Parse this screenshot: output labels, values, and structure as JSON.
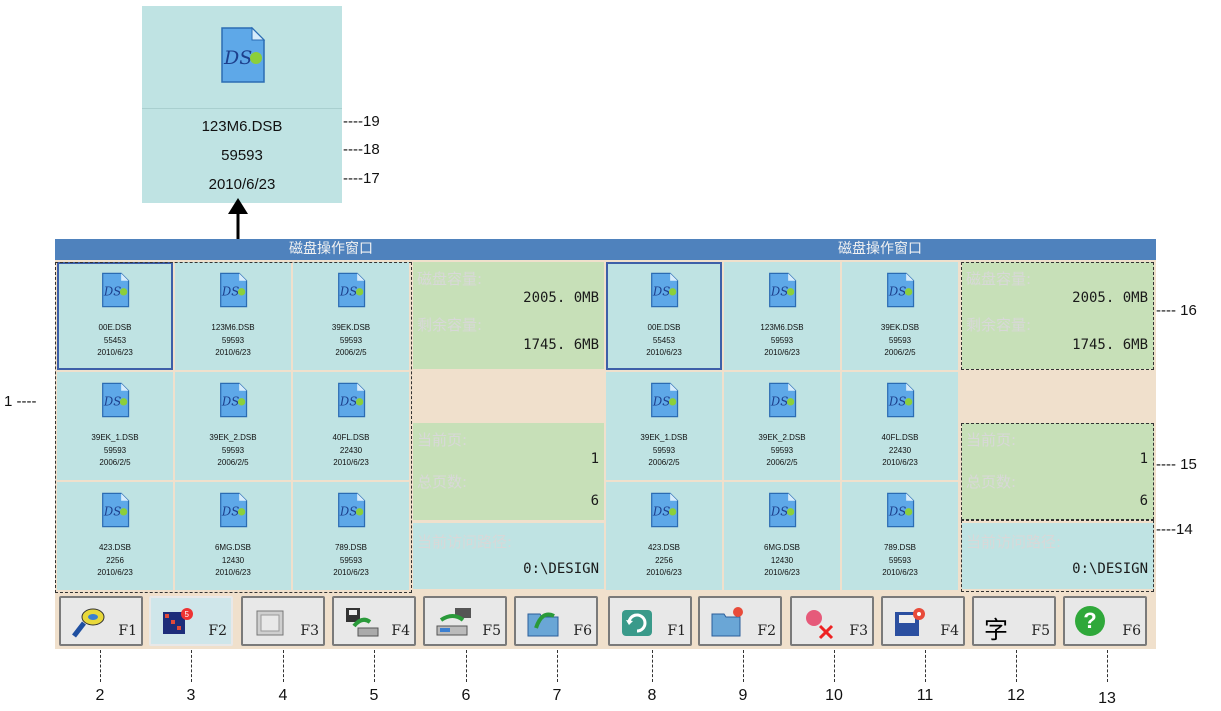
{
  "zoom": {
    "filename": "123M6.DSB",
    "size": "59593",
    "date": "2010/6/23"
  },
  "callouts": {
    "c19": "----19",
    "c18": "----18",
    "c17": "----17",
    "c16": "---- 16",
    "c15": "---- 15",
    "c14": "----14",
    "c1": "1 ----"
  },
  "windows": [
    {
      "title": "磁盘操作窗口",
      "disk_label": "磁盘容量:",
      "disk_value": "2005. 0MB",
      "free_label": "剩余容量:",
      "free_value": "1745. 6MB",
      "page_label": "当前页:",
      "page_value": "1",
      "total_label": "总页数:",
      "total_value": "6",
      "path_label": "当前访问路径:",
      "path_value": "0:\\DESIGN",
      "files": [
        {
          "name": "00E.DSB",
          "size": "55453",
          "date": "2010/6/23"
        },
        {
          "name": "123M6.DSB",
          "size": "59593",
          "date": "2010/6/23"
        },
        {
          "name": "39EK.DSB",
          "size": "59593",
          "date": "2006/2/5"
        },
        {
          "name": "39EK_1.DSB",
          "size": "59593",
          "date": "2006/2/5"
        },
        {
          "name": "39EK_2.DSB",
          "size": "59593",
          "date": "2006/2/5"
        },
        {
          "name": "40FL.DSB",
          "size": "22430",
          "date": "2010/6/23"
        },
        {
          "name": "423.DSB",
          "size": "2256",
          "date": "2010/6/23"
        },
        {
          "name": "6MG.DSB",
          "size": "12430",
          "date": "2010/6/23"
        },
        {
          "name": "789.DSB",
          "size": "59593",
          "date": "2010/6/23"
        }
      ]
    },
    {
      "title": "磁盘操作窗口",
      "disk_label": "磁盘容量:",
      "disk_value": "2005. 0MB",
      "free_label": "剩余容量:",
      "free_value": "1745. 6MB",
      "page_label": "当前页:",
      "page_value": "1",
      "total_label": "总页数:",
      "total_value": "6",
      "path_label": "当前访问路径:",
      "path_value": "0:\\DESIGN",
      "files": [
        {
          "name": "00E.DSB",
          "size": "55453",
          "date": "2010/6/23"
        },
        {
          "name": "123M6.DSB",
          "size": "59593",
          "date": "2010/6/23"
        },
        {
          "name": "39EK.DSB",
          "size": "59593",
          "date": "2006/2/5"
        },
        {
          "name": "39EK_1.DSB",
          "size": "59593",
          "date": "2006/2/5"
        },
        {
          "name": "39EK_2.DSB",
          "size": "59593",
          "date": "2006/2/5"
        },
        {
          "name": "40FL.DSB",
          "size": "22430",
          "date": "2010/6/23"
        },
        {
          "name": "423.DSB",
          "size": "2256",
          "date": "2010/6/23"
        },
        {
          "name": "6MG.DSB",
          "size": "12430",
          "date": "2010/6/23"
        },
        {
          "name": "789.DSB",
          "size": "59593",
          "date": "2010/6/23"
        }
      ]
    }
  ],
  "buttons": [
    {
      "key": "F1",
      "icon": "search-key-icon"
    },
    {
      "key": "F2",
      "icon": "grid-view-icon"
    },
    {
      "key": "F3",
      "icon": "image-view-icon"
    },
    {
      "key": "F4",
      "icon": "copy-to-disk-icon"
    },
    {
      "key": "F5",
      "icon": "transfer-disk-icon"
    },
    {
      "key": "F6",
      "icon": "open-folder-icon"
    },
    {
      "key": "F1",
      "icon": "refresh-icon"
    },
    {
      "key": "F2",
      "icon": "new-folder-icon"
    },
    {
      "key": "F3",
      "icon": "delete-icon"
    },
    {
      "key": "F4",
      "icon": "disk-settings-icon"
    },
    {
      "key": "F5",
      "icon": "font-icon",
      "glyph": "字"
    },
    {
      "key": "F6",
      "icon": "help-icon",
      "glyph": "?"
    }
  ],
  "numbers": [
    "2",
    "3",
    "4",
    "5",
    "6",
    "7",
    "8",
    "9",
    "10",
    "11",
    "12",
    "13"
  ],
  "file_badge": "DS"
}
